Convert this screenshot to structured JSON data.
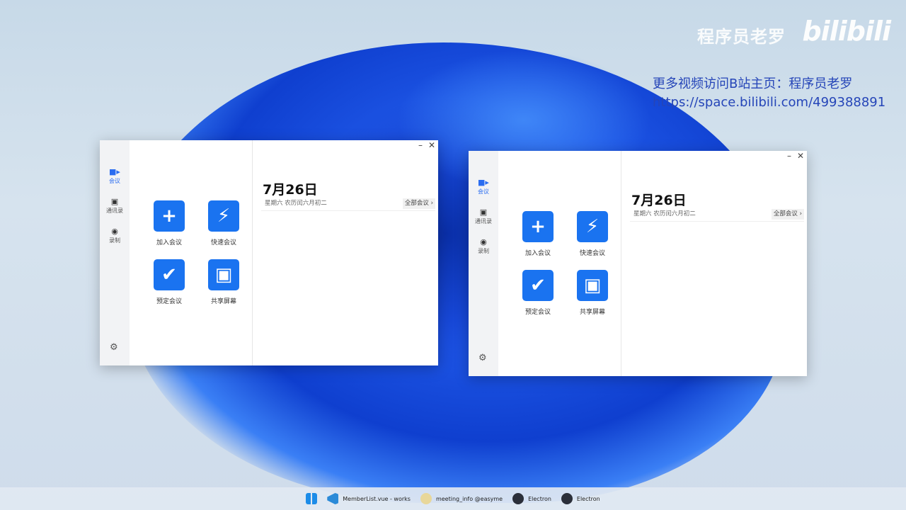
{
  "watermark": {
    "channel": "程序员老罗",
    "logo": "bilibili"
  },
  "promo": {
    "line1": "更多视频访问B站主页：程序员老罗",
    "line2": "https://space.bilibili.com/499388891"
  },
  "app": {
    "nav": [
      {
        "label": "会议",
        "icon": "video-icon"
      },
      {
        "label": "通讯录",
        "icon": "contacts-icon"
      },
      {
        "label": "录制",
        "icon": "record-icon"
      }
    ],
    "actions": [
      {
        "label": "加入会议",
        "icon": "+"
      },
      {
        "label": "快速会议",
        "icon": "⚡"
      },
      {
        "label": "预定会议",
        "icon": "✔"
      },
      {
        "label": "共享屏幕",
        "icon": "▣"
      }
    ],
    "date": "7月26日",
    "subtitle": "星期六 农历闰六月初二",
    "all_meetings": "全部会议",
    "minimize": "–",
    "close": "✕",
    "active_color": "#1a73f0"
  },
  "taskbar": [
    {
      "label": "MemberList.vue - works"
    },
    {
      "label": "meeting_info @easyme"
    },
    {
      "label": "Electron"
    },
    {
      "label": "Electron"
    }
  ]
}
